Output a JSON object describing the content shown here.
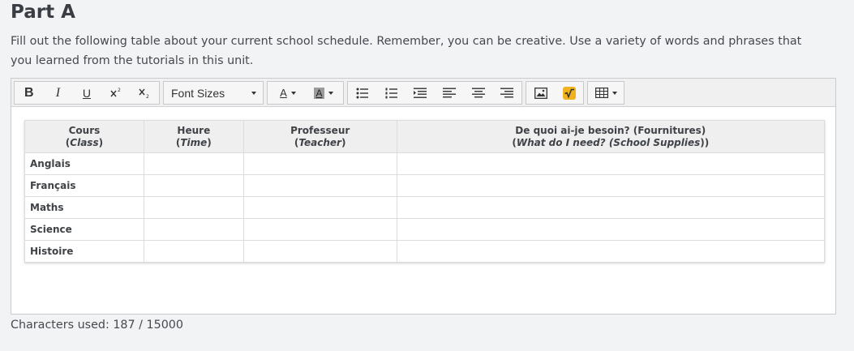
{
  "page": {
    "title": "Part A",
    "instructions": "Fill out the following table about your current school schedule. Remember, you can be creative. Use a variety of words and phrases that you learned from the tutorials in this unit."
  },
  "toolbar": {
    "bold": "B",
    "italic": "I",
    "underline": "U",
    "font_sizes_label": "Font Sizes",
    "font_color_label": "A",
    "highlight_label": "A"
  },
  "table": {
    "headers": [
      {
        "main": "Cours",
        "sub_open": "(",
        "sub_em": "Class",
        "sub_close": ")"
      },
      {
        "main": "Heure",
        "sub_open": "(",
        "sub_em": "Time",
        "sub_close": ")"
      },
      {
        "main": "Professeur",
        "sub_open": "(",
        "sub_em": "Teacher",
        "sub_close": ")"
      },
      {
        "main": "De quoi ai-je besoin? (Fournitures)",
        "sub_open": "(",
        "sub_em": "What do I need? (School Supplies",
        "sub_close": "))"
      }
    ],
    "rows": [
      "Anglais",
      "Français",
      "Maths",
      "Science",
      "Histoire"
    ]
  },
  "footer": {
    "counter": "Characters used: 187 / 15000"
  },
  "colors": {
    "background": "#f2f3f5",
    "editor_bg": "#ffffff",
    "toolbar_bg": "#f0f0f0",
    "header_bg": "#efefef",
    "math_icon": "#f0b21f"
  }
}
